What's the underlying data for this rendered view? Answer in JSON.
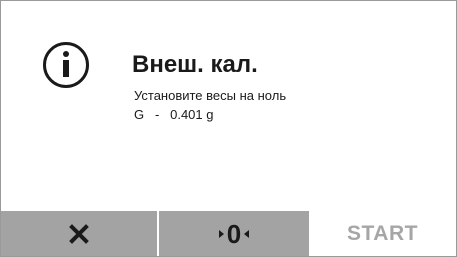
{
  "dialog": {
    "title": "Внеш. кал.",
    "message": "Установите весы на ноль",
    "reading": "G   -   0.401 g",
    "icon": "info-icon"
  },
  "buttons": {
    "cancel_icon": "close-icon",
    "zero_label": "0",
    "start_label": "START"
  },
  "colors": {
    "button_bg": "#a3a3a3",
    "start_text": "#a6a6a6",
    "text": "#1a1a1a"
  }
}
